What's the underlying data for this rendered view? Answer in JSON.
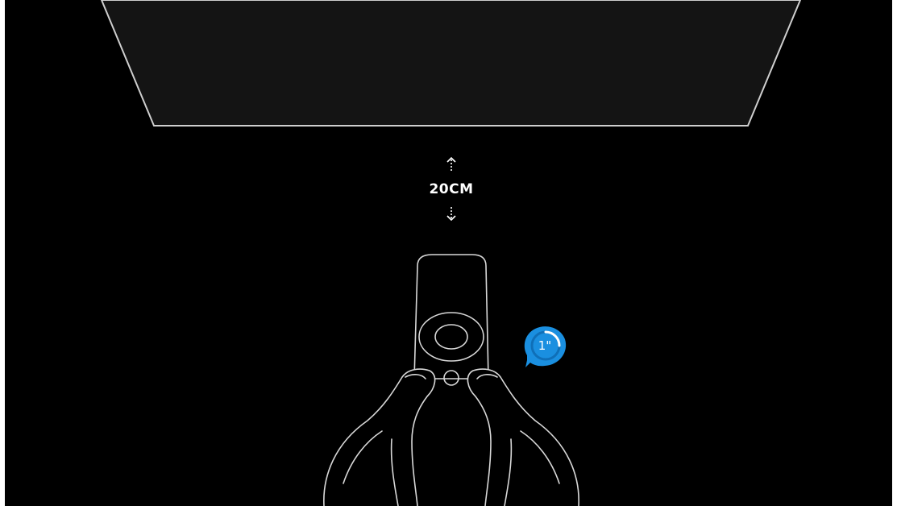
{
  "guide": {
    "distance_label": "20CM",
    "countdown_label": "1\"",
    "countdown_progress": 0.25
  },
  "icons": {
    "up": "arrow-up-icon",
    "down": "arrow-down-icon",
    "timer": "countdown-timer-icon"
  },
  "colors": {
    "background": "#000000",
    "outline": "#d8d8d8",
    "tv_fill": "#141414",
    "timer_blue": "#1a8fe0",
    "timer_blue_dark": "#0f6fb8"
  }
}
